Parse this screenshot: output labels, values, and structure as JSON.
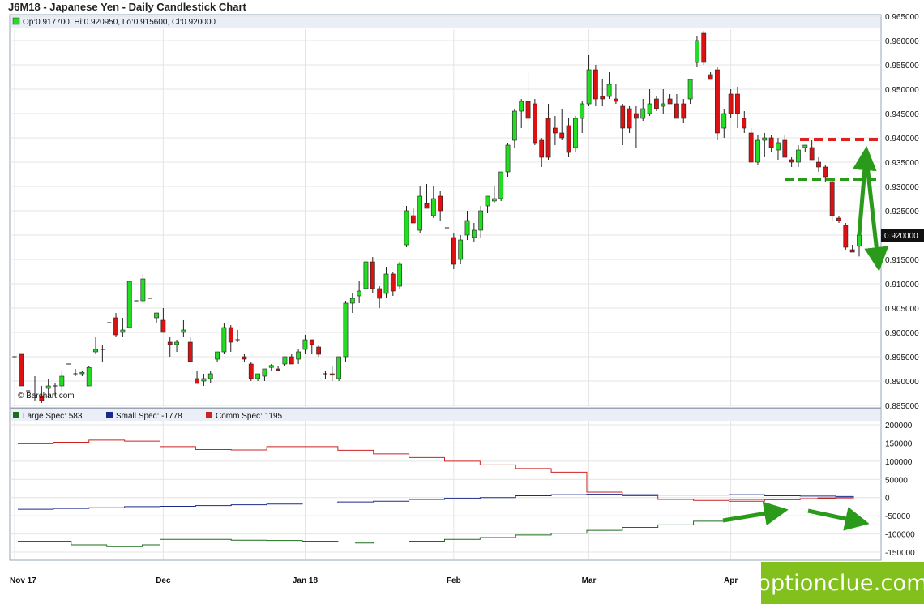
{
  "title": "J6M18 - Japanese Yen - Daily Candlestick Chart",
  "credit": "© Barchart.com",
  "watermark": "optionclue.com",
  "price_legend": "Op:0.917700, Hi:0.920950, Lo:0.915600, Cl:0.920000",
  "last_price_label": "0.920000",
  "colors": {
    "up": "#22dd22",
    "down": "#dd1111",
    "large_spec": "#1a6e1a",
    "small_spec": "#1a2a8c",
    "comm_spec": "#cc2222",
    "arrows": "#2a9a1a",
    "red_dash": "#dd2222",
    "green_dash": "#2a9a1a"
  },
  "chart_data": [
    {
      "type": "candlestick",
      "title": "J6M18 - Japanese Yen - Daily Candlestick Chart",
      "ylim": [
        0.885,
        0.965
      ],
      "y_ticks": [
        "0.885000",
        "0.890000",
        "0.895000",
        "0.900000",
        "0.905000",
        "0.910000",
        "0.915000",
        "0.920000",
        "0.925000",
        "0.930000",
        "0.935000",
        "0.940000",
        "0.945000",
        "0.950000",
        "0.955000",
        "0.960000",
        "0.965000"
      ],
      "x_labels": [
        "Nov 17",
        "Dec",
        "Jan 18",
        "Feb",
        "Mar",
        "Apr"
      ],
      "x_label_index": [
        0,
        22,
        43,
        65,
        85,
        106
      ],
      "last_bar": {
        "open": 0.9177,
        "high": 0.92095,
        "low": 0.9156,
        "close": 0.92
      },
      "candles": [
        [
          0.895,
          0.895,
          0.895,
          0.895
        ],
        [
          0.8955,
          0.8955,
          0.889,
          0.889
        ],
        [
          0.888,
          0.888,
          0.888,
          0.888
        ],
        [
          0.887,
          0.891,
          0.886,
          0.887
        ],
        [
          0.887,
          0.889,
          0.8855,
          0.886
        ],
        [
          0.8885,
          0.8905,
          0.8865,
          0.889
        ],
        [
          0.889,
          0.8895,
          0.887,
          0.889
        ],
        [
          0.889,
          0.892,
          0.888,
          0.891
        ],
        [
          0.8935,
          0.8935,
          0.8935,
          0.8935
        ],
        [
          0.8915,
          0.8925,
          0.891,
          0.8915
        ],
        [
          0.8915,
          0.892,
          0.891,
          0.8918
        ],
        [
          0.889,
          0.893,
          0.889,
          0.8928
        ],
        [
          0.896,
          0.899,
          0.8955,
          0.8965
        ],
        [
          0.8965,
          0.8975,
          0.894,
          0.8965
        ],
        [
          0.902,
          0.902,
          0.902,
          0.902
        ],
        [
          0.903,
          0.904,
          0.899,
          0.8995
        ],
        [
          0.9,
          0.903,
          0.899,
          0.9005
        ],
        [
          0.901,
          0.9105,
          0.901,
          0.9105
        ],
        [
          0.9065,
          0.9065,
          0.9065,
          0.9065
        ],
        [
          0.9065,
          0.912,
          0.906,
          0.911
        ],
        [
          0.907,
          0.907,
          0.907,
          0.907
        ],
        [
          0.903,
          0.904,
          0.902,
          0.904
        ],
        [
          0.9025,
          0.905,
          0.9005,
          0.9
        ],
        [
          0.898,
          0.899,
          0.895,
          0.8975
        ],
        [
          0.8975,
          0.8985,
          0.896,
          0.898
        ],
        [
          0.9,
          0.9025,
          0.899,
          0.9005
        ],
        [
          0.898,
          0.899,
          0.894,
          0.894
        ],
        [
          0.8905,
          0.892,
          0.8895,
          0.8895
        ],
        [
          0.89,
          0.8915,
          0.889,
          0.8905
        ],
        [
          0.8905,
          0.892,
          0.8895,
          0.8915
        ],
        [
          0.8945,
          0.896,
          0.894,
          0.896
        ],
        [
          0.896,
          0.902,
          0.8955,
          0.901
        ],
        [
          0.901,
          0.9015,
          0.896,
          0.898
        ],
        [
          0.8985,
          0.9005,
          0.898,
          0.8985
        ],
        [
          0.895,
          0.8955,
          0.894,
          0.8945
        ],
        [
          0.8935,
          0.894,
          0.89,
          0.8905
        ],
        [
          0.8905,
          0.8915,
          0.89,
          0.8915
        ],
        [
          0.891,
          0.8925,
          0.89,
          0.8925
        ],
        [
          0.8928,
          0.8935,
          0.892,
          0.8932
        ],
        [
          0.8925,
          0.893,
          0.892,
          0.8922
        ],
        [
          0.8935,
          0.895,
          0.893,
          0.895
        ],
        [
          0.895,
          0.8955,
          0.8935,
          0.8935
        ],
        [
          0.8945,
          0.8965,
          0.8935,
          0.896
        ],
        [
          0.8965,
          0.8995,
          0.8955,
          0.8985
        ],
        [
          0.8985,
          0.8985,
          0.8955,
          0.8975
        ],
        [
          0.897,
          0.8975,
          0.895,
          0.8955
        ],
        [
          0.8915,
          0.892,
          0.8905,
          0.8915
        ],
        [
          0.8915,
          0.893,
          0.89,
          0.8912
        ],
        [
          0.8905,
          0.895,
          0.89,
          0.895
        ],
        [
          0.895,
          0.9065,
          0.894,
          0.906
        ],
        [
          0.906,
          0.908,
          0.904,
          0.907
        ],
        [
          0.9075,
          0.9105,
          0.906,
          0.9085
        ],
        [
          0.909,
          0.915,
          0.908,
          0.9145
        ],
        [
          0.9145,
          0.9155,
          0.908,
          0.909
        ],
        [
          0.909,
          0.9095,
          0.905,
          0.907
        ],
        [
          0.908,
          0.9135,
          0.907,
          0.912
        ],
        [
          0.912,
          0.9125,
          0.9075,
          0.9085
        ],
        [
          0.9095,
          0.9145,
          0.909,
          0.914
        ],
        [
          0.918,
          0.926,
          0.9175,
          0.925
        ],
        [
          0.924,
          0.9255,
          0.9225,
          0.9225
        ],
        [
          0.921,
          0.93,
          0.9205,
          0.928
        ],
        [
          0.9265,
          0.9305,
          0.926,
          0.9255
        ],
        [
          0.924,
          0.93,
          0.9235,
          0.9275
        ],
        [
          0.928,
          0.929,
          0.923,
          0.925
        ],
        [
          0.9215,
          0.922,
          0.9195,
          0.9215
        ],
        [
          0.9195,
          0.9205,
          0.913,
          0.914
        ],
        [
          0.915,
          0.92,
          0.914,
          0.919
        ],
        [
          0.92,
          0.925,
          0.919,
          0.923
        ],
        [
          0.9195,
          0.9225,
          0.9185,
          0.921
        ],
        [
          0.921,
          0.926,
          0.9195,
          0.925
        ],
        [
          0.926,
          0.928,
          0.9245,
          0.928
        ],
        [
          0.927,
          0.93,
          0.9265,
          0.9275
        ],
        [
          0.9275,
          0.933,
          0.927,
          0.933
        ],
        [
          0.933,
          0.939,
          0.932,
          0.9385
        ],
        [
          0.9395,
          0.946,
          0.938,
          0.9455
        ],
        [
          0.9455,
          0.948,
          0.942,
          0.9475
        ],
        [
          0.9475,
          0.9535,
          0.941,
          0.944
        ],
        [
          0.947,
          0.948,
          0.9385,
          0.939
        ],
        [
          0.9395,
          0.94,
          0.934,
          0.936
        ],
        [
          0.944,
          0.947,
          0.9355,
          0.936
        ],
        [
          0.942,
          0.9445,
          0.9385,
          0.941
        ],
        [
          0.941,
          0.946,
          0.9395,
          0.94
        ],
        [
          0.9425,
          0.944,
          0.936,
          0.937
        ],
        [
          0.938,
          0.9445,
          0.937,
          0.944
        ],
        [
          0.944,
          0.9475,
          0.941,
          0.947
        ],
        [
          0.947,
          0.957,
          0.9465,
          0.954
        ],
        [
          0.954,
          0.955,
          0.9465,
          0.948
        ],
        [
          0.9485,
          0.952,
          0.9465,
          0.948
        ],
        [
          0.9485,
          0.9535,
          0.948,
          0.951
        ],
        [
          0.948,
          0.951,
          0.947,
          0.9475
        ],
        [
          0.9465,
          0.947,
          0.9385,
          0.942
        ],
        [
          0.946,
          0.9465,
          0.941,
          0.942
        ],
        [
          0.945,
          0.9465,
          0.938,
          0.944
        ],
        [
          0.944,
          0.948,
          0.9435,
          0.946
        ],
        [
          0.945,
          0.95,
          0.9445,
          0.947
        ],
        [
          0.948,
          0.9485,
          0.9455,
          0.946
        ],
        [
          0.9465,
          0.95,
          0.945,
          0.947
        ],
        [
          0.948,
          0.949,
          0.947,
          0.947
        ],
        [
          0.947,
          0.949,
          0.944,
          0.944
        ],
        [
          0.947,
          0.948,
          0.943,
          0.944
        ],
        [
          0.948,
          0.952,
          0.947,
          0.952
        ],
        [
          0.9555,
          0.961,
          0.9545,
          0.96
        ],
        [
          0.9615,
          0.962,
          0.955,
          0.9555
        ],
        [
          0.953,
          0.9535,
          0.952,
          0.952
        ],
        [
          0.954,
          0.9545,
          0.9395,
          0.941
        ],
        [
          0.942,
          0.946,
          0.94,
          0.945
        ],
        [
          0.949,
          0.95,
          0.944,
          0.945
        ],
        [
          0.949,
          0.9505,
          0.942,
          0.945
        ],
        [
          0.944,
          0.9455,
          0.941,
          0.942
        ],
        [
          0.941,
          0.942,
          0.935,
          0.935
        ],
        [
          0.935,
          0.9405,
          0.9345,
          0.9395
        ],
        [
          0.9395,
          0.941,
          0.936,
          0.94
        ],
        [
          0.94,
          0.9405,
          0.937,
          0.938
        ],
        [
          0.9375,
          0.94,
          0.9355,
          0.939
        ],
        [
          0.9395,
          0.9405,
          0.936,
          0.936
        ],
        [
          0.9355,
          0.936,
          0.934,
          0.935
        ],
        [
          0.935,
          0.9385,
          0.934,
          0.9375
        ],
        [
          0.938,
          0.9385,
          0.937,
          0.9385
        ],
        [
          0.938,
          0.9395,
          0.936,
          0.9355
        ],
        [
          0.935,
          0.936,
          0.933,
          0.934
        ],
        [
          0.934,
          0.9345,
          0.931,
          0.932
        ],
        [
          0.931,
          0.9315,
          0.923,
          0.924
        ],
        [
          0.9235,
          0.924,
          0.9225,
          0.923
        ],
        [
          0.922,
          0.9225,
          0.917,
          0.9175
        ],
        [
          0.917,
          0.918,
          0.9165,
          0.9165
        ],
        [
          0.9177,
          0.92095,
          0.9156,
          0.92
        ]
      ]
    },
    {
      "type": "line",
      "title": "",
      "ylim": [
        -170000,
        210000
      ],
      "y_ticks": [
        "200000",
        "150000",
        "100000",
        "50000",
        "0",
        "-50000",
        "-100000",
        "-150000"
      ],
      "x_labels": [
        "Nov 17",
        "Dec",
        "Jan 18",
        "Feb",
        "Mar",
        "Apr"
      ],
      "series": [
        {
          "name": "Large Spec: 583",
          "color": "#1a6e1a",
          "step": true,
          "values": [
            -120000,
            -120000,
            -120000,
            -130000,
            -130000,
            -135000,
            -135000,
            -130000,
            -115000,
            -115000,
            -115000,
            -115000,
            -117000,
            -117000,
            -118000,
            -118000,
            -120000,
            -120000,
            -122000,
            -125000,
            -122000,
            -122000,
            -120000,
            -120000,
            -115000,
            -115000,
            -110000,
            -110000,
            -103000,
            -103000,
            -98000,
            -98000,
            -90000,
            -90000,
            -82000,
            -82000,
            -75000,
            -75000,
            -65000,
            -65000,
            -5000,
            -5000,
            -5000,
            -5000,
            -3000,
            -1000,
            0,
            583
          ]
        },
        {
          "name": "Small Spec: -1778",
          "color": "#1a2a8c",
          "step": true,
          "values": [
            -32000,
            -32000,
            -30000,
            -30000,
            -28000,
            -28000,
            -25000,
            -25000,
            -24000,
            -24000,
            -22000,
            -22000,
            -20000,
            -20000,
            -18000,
            -18000,
            -15000,
            -15000,
            -12000,
            -12000,
            -10000,
            -10000,
            -5000,
            -5000,
            -2000,
            -2000,
            0,
            0,
            5000,
            5000,
            8000,
            8000,
            9000,
            9000,
            8000,
            8000,
            7000,
            7000,
            7000,
            7000,
            8000,
            8000,
            5000,
            5000,
            4000,
            4000,
            3000,
            -1778
          ]
        },
        {
          "name": "Comm Spec: 1195",
          "color": "#cc2222",
          "step": true,
          "values": [
            148000,
            148000,
            152000,
            152000,
            158000,
            158000,
            155000,
            155000,
            140000,
            140000,
            132000,
            132000,
            131000,
            131000,
            140000,
            140000,
            140000,
            140000,
            130000,
            130000,
            120000,
            120000,
            110000,
            110000,
            100000,
            100000,
            90000,
            90000,
            80000,
            80000,
            70000,
            70000,
            15000,
            15000,
            5000,
            5000,
            -5000,
            -5000,
            -8000,
            -8000,
            -10000,
            -10000,
            -6000,
            -6000,
            -3000,
            -2000,
            -1000,
            1195
          ]
        }
      ]
    }
  ]
}
